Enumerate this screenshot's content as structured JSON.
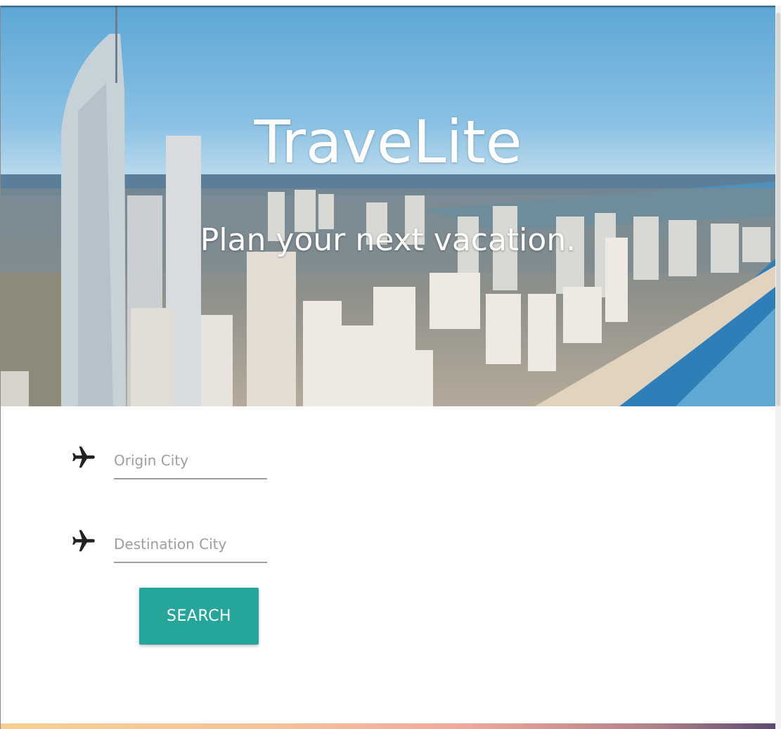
{
  "hero": {
    "title": "TraveLite",
    "subtitle": "Plan your next vacation."
  },
  "form": {
    "origin": {
      "placeholder": "Origin City",
      "icon": "airplane-icon"
    },
    "destination": {
      "placeholder": "Destination City",
      "icon": "airplane-icon"
    },
    "search_label": "SEARCH"
  },
  "colors": {
    "accent": "#26a69a",
    "underline": "#9e9e9e",
    "icon": "#222222"
  }
}
